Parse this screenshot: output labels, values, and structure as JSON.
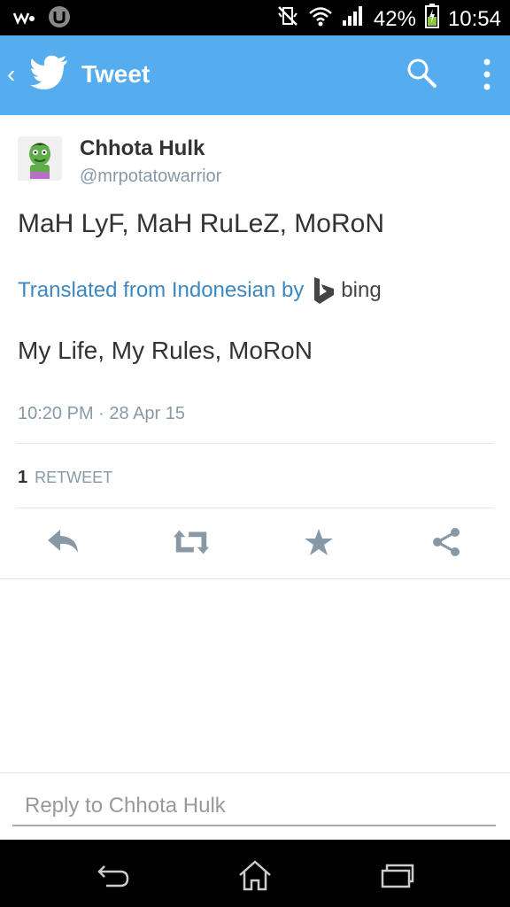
{
  "status_bar": {
    "battery_percent": "42%",
    "time": "10:54"
  },
  "app_bar": {
    "title": "Tweet"
  },
  "tweet": {
    "display_name": "Chhota Hulk",
    "handle": "@mrpotatowarrior",
    "text": "MaH LyF, MaH RuLeZ, MoRoN",
    "translated_label": "Translated from Indonesian by",
    "translator": "bing",
    "translation": "My Life, My Rules, MoRoN",
    "timestamp": "10:20 PM · 28 Apr 15",
    "retweet_count": "1",
    "retweet_label": "RETWEET"
  },
  "reply": {
    "placeholder": "Reply to Chhota Hulk"
  },
  "colors": {
    "twitter_blue": "#55acee",
    "link_blue": "#3b88c3",
    "icon_gray": "#8899a6"
  }
}
